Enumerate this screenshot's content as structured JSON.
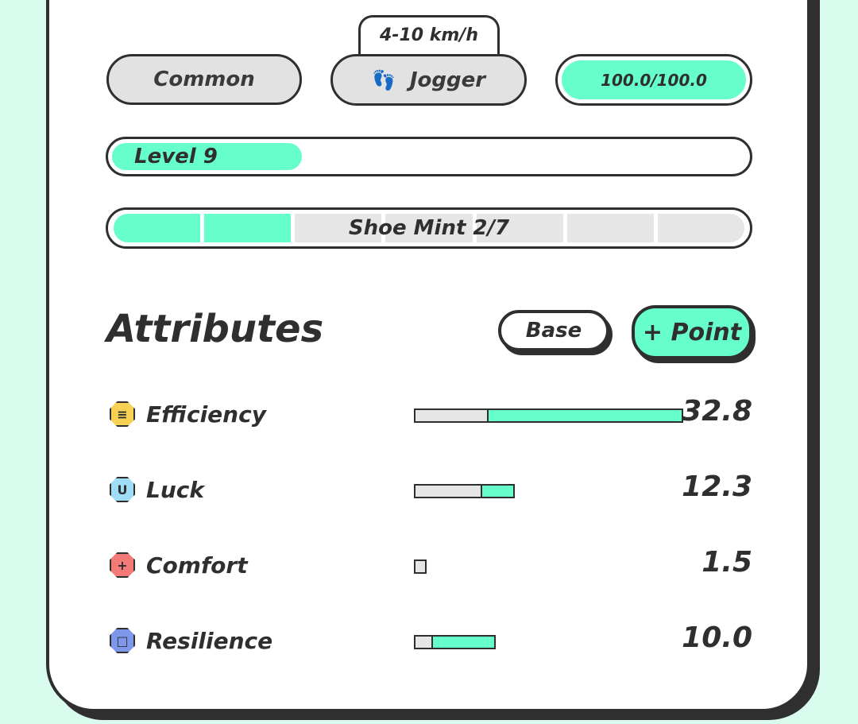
{
  "colors": {
    "accent": "#66ffcc",
    "background": "#d9fbee",
    "ink": "#2f2f2f"
  },
  "sneaker": {
    "rarity": "Common",
    "speed_range": "4-10 km/h",
    "type": {
      "label": "Jogger",
      "icon": "footprints-icon"
    },
    "durability": {
      "text": "100.0/100.0",
      "fraction": 1.0
    },
    "level": {
      "text": "Level 9",
      "fraction": 0.3
    },
    "mint": {
      "text": "Shoe Mint 2/7",
      "used": 2,
      "total": 7
    }
  },
  "attributes": {
    "title": "Attributes",
    "base_label": "Base",
    "point_label": "+ Point",
    "bar_max": 32.8,
    "items": [
      {
        "name": "Efficiency",
        "value": "32.8",
        "base": 9.0,
        "total": 32.8,
        "icon": "efficiency-icon",
        "glyph": "≡",
        "color": "#f7d154"
      },
      {
        "name": "Luck",
        "value": "12.3",
        "base": 8.4,
        "total": 12.3,
        "icon": "luck-icon",
        "glyph": "U",
        "color": "#9fdcf5"
      },
      {
        "name": "Comfort",
        "value": "1.5",
        "base": 1.5,
        "total": 1.5,
        "icon": "comfort-icon",
        "glyph": "+",
        "color": "#f47a7a"
      },
      {
        "name": "Resilience",
        "value": "10.0",
        "base": 2.2,
        "total": 10.0,
        "icon": "resilience-icon",
        "glyph": "□",
        "color": "#7e97ea"
      }
    ]
  }
}
